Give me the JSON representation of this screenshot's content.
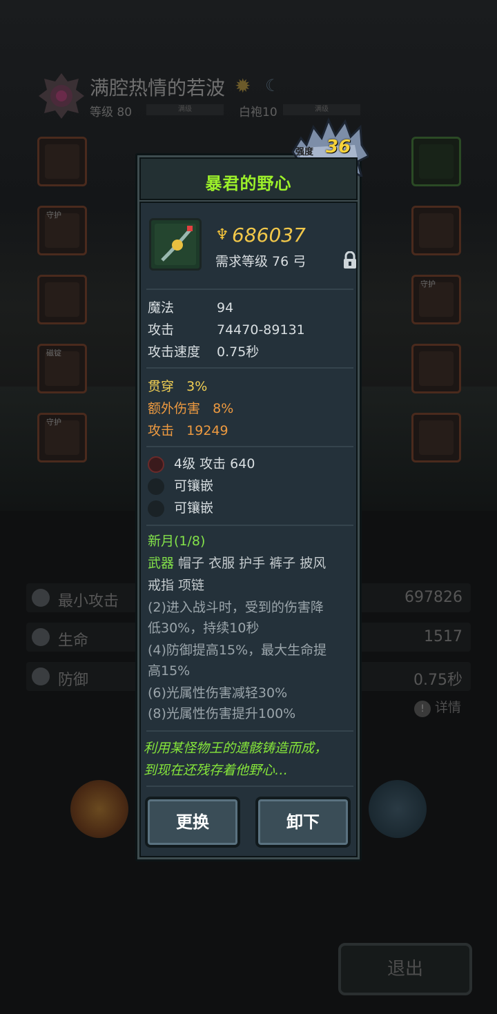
{
  "hero": {
    "name": "满腔热情的若波",
    "level_label": "等级 80",
    "level_bar_text": "满级",
    "class_label": "白袍10",
    "class_bar_text": "满级"
  },
  "slots": {
    "left_tags": [
      "",
      "守护",
      "",
      "磁锭",
      "守护"
    ],
    "right_tags": [
      "",
      "",
      "守护",
      "",
      ""
    ]
  },
  "stats": [
    {
      "label": "最小攻击",
      "value": "697826"
    },
    {
      "label": "生命",
      "value": "1517"
    },
    {
      "label": "防御",
      "value": "0.75秒"
    }
  ],
  "detail_link": "详情",
  "exit_label": "退出",
  "dialog": {
    "title": "暴君的野心",
    "strength_label": "强度",
    "strength_value": "36",
    "gold_value": "686037",
    "requirement": "需求等级 76   弓",
    "base_stats": [
      {
        "key": "魔法",
        "value": "94"
      },
      {
        "key": "攻击",
        "value": "74470-89131"
      },
      {
        "key": "攻击速度",
        "value": "0.75秒"
      }
    ],
    "bonus_stats": [
      {
        "key": "贯穿",
        "value": "3%",
        "color": "#f1cf54"
      },
      {
        "key": "额外伤害",
        "value": "8%",
        "color": "#ee9a40"
      },
      {
        "key": "攻击",
        "value": "19249",
        "color": "#ee9a40"
      }
    ],
    "sockets": [
      {
        "text": "4级  攻击 640",
        "filled": true
      },
      {
        "text": "可镶嵌",
        "filled": false
      },
      {
        "text": "可镶嵌",
        "filled": false
      }
    ],
    "set": {
      "title": "新月(1/8)",
      "pieces_active": "武器",
      "pieces_line1_rest": " 帽子 衣服 护手 裤子 披风",
      "pieces_line2": "戒指 项链",
      "effects": [
        "(2)进入战斗时，受到的伤害降",
        "低30%，持续10秒",
        "(4)防御提高15%，最大生命提",
        "高15%",
        "(6)光属性伤害减轻30%",
        "(8)光属性伤害提升100%"
      ]
    },
    "flavor": [
      "利用某怪物王的遗骸铸造而成，",
      "到现在还残存着他野心…"
    ],
    "buttons": {
      "replace": "更换",
      "unequip": "卸下"
    }
  }
}
